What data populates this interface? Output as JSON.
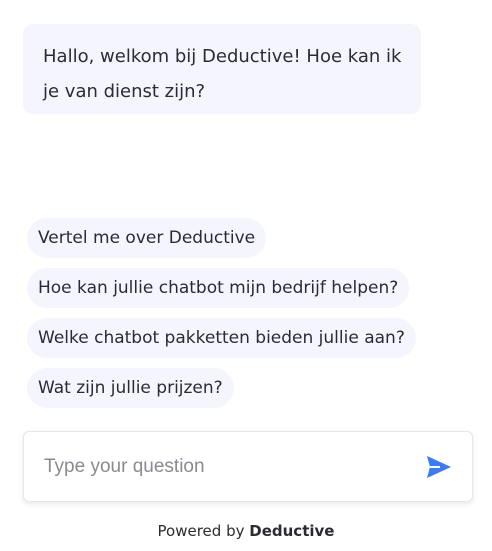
{
  "chat": {
    "welcome_message": "Hallo, welkom bij Deductive! Hoe kan ik je van dienst zijn?"
  },
  "suggestions": [
    {
      "label": "Vertel me over Deductive"
    },
    {
      "label": "Hoe kan jullie chatbot mijn bedrijf helpen?"
    },
    {
      "label": "Welke chatbot pakketten bieden jullie aan?"
    },
    {
      "label": "Wat zijn jullie prijzen?"
    }
  ],
  "composer": {
    "placeholder": "Type your question",
    "value": "",
    "send_icon": "send-icon"
  },
  "footer": {
    "powered_by": "Powered by",
    "brand": "Deductive"
  },
  "colors": {
    "bubble_background": "#f5f5fd",
    "send_icon": "#3d7bf0"
  }
}
